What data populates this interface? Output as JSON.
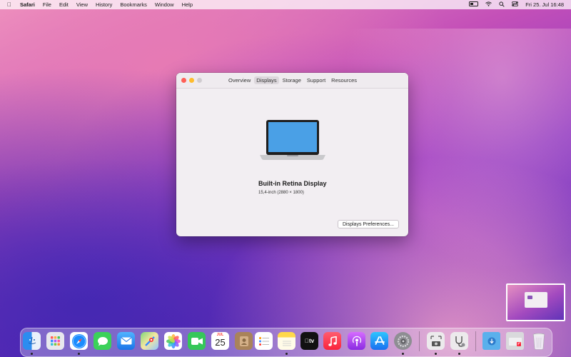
{
  "menubar": {
    "apple_icon": "apple-icon",
    "app_name": "Safari",
    "items": [
      "File",
      "Edit",
      "View",
      "History",
      "Bookmarks",
      "Window",
      "Help"
    ],
    "datetime": "Fri 25. Jul  16:48"
  },
  "window": {
    "tabs": [
      "Overview",
      "Displays",
      "Storage",
      "Support",
      "Resources"
    ],
    "active_tab": "Displays",
    "display_name": "Built-in Retina Display",
    "display_size": "15,4-inch (2880 × 1800)",
    "prefs_button": "Displays Preferences..."
  },
  "dock": {
    "calendar_month": "JUL",
    "calendar_day": "25",
    "tv_label": "tv",
    "apps": [
      "Finder",
      "Launchpad",
      "Safari",
      "Messages",
      "Mail",
      "Maps",
      "Photos",
      "FaceTime",
      "Calendar",
      "Contacts",
      "Reminders",
      "Notes",
      "TV",
      "Music",
      "Podcasts",
      "App Store",
      "System Preferences",
      "Screenshot",
      "System Information",
      "Downloads",
      "Documents",
      "Trash"
    ]
  },
  "colors": {
    "close": "#ff5f57",
    "minimize": "#febc2e",
    "accent": "#2f7cf6"
  }
}
